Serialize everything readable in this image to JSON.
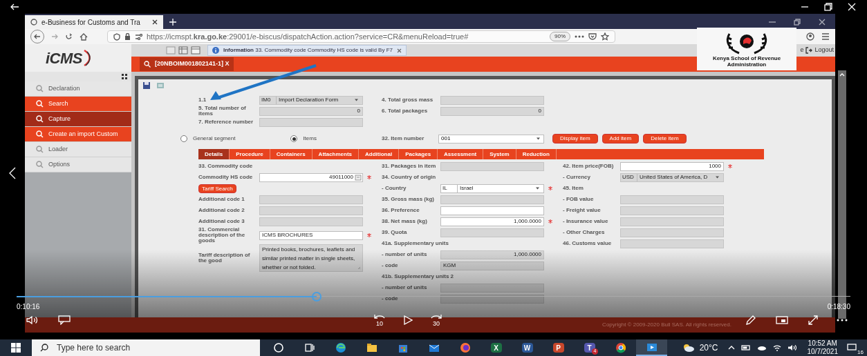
{
  "browser": {
    "tab_title": "e-Business for Customs and Tra",
    "url": "https://icmspt.**kra.go.ke**:29001/e-biscus/dispatchAction.action?service=CR&menuReload=true#",
    "zoom": "90%"
  },
  "app": {
    "logo": "iCMS",
    "info_tab": "**Information** 33. Commodity code Commodity HS code is valid By F7",
    "document_tab": "[20NBOIM001802141-1] X",
    "header_links": [
      "e",
      "Logout"
    ],
    "copyright": "Copyright © 2009-2020 Bull SAS. All rights reserved."
  },
  "overlay_logo": {
    "text": "Kenya School of Revenue Administration"
  },
  "sidebar": [
    {
      "label": "Declaration",
      "kind": "module",
      "selected": false
    },
    {
      "label": "Search",
      "kind": "action",
      "selected": false
    },
    {
      "label": "Capture",
      "kind": "action",
      "selected": true
    },
    {
      "label": "Create an import Custom",
      "kind": "action",
      "selected": false
    },
    {
      "label": "Loader",
      "kind": "module",
      "selected": false
    },
    {
      "label": "Options",
      "kind": "module",
      "selected": false
    }
  ],
  "form": {
    "header_columns": [
      {
        "rows": [
          {
            "kind": "select",
            "label": "1.1",
            "code": "IM0",
            "value": "Import Declaration Form",
            "editable": false,
            "required": false
          },
          {
            "kind": "number",
            "label": "5. Total number of items",
            "value": "0",
            "editable": false,
            "required": false
          },
          {
            "kind": "text",
            "label": "7. Reference number",
            "editable": false,
            "required": false
          }
        ]
      },
      {
        "rows": [
          {
            "kind": "text",
            "label": "4. Total gross mass",
            "editable": false,
            "required": false
          },
          {
            "kind": "number",
            "label": "6. Total packages",
            "value": "0",
            "editable": false,
            "required": false
          }
        ]
      }
    ],
    "segments": [
      {
        "label": "General segment",
        "selected": false
      },
      {
        "label": "Items",
        "selected": true
      }
    ],
    "item_number": {
      "label": "32. Item number",
      "value": "001"
    },
    "item_buttons": [
      "Display item",
      "Add item",
      "Delete item"
    ],
    "tabs": [
      {
        "label": "Details",
        "selected": true
      },
      {
        "label": "Procedure",
        "selected": false
      },
      {
        "label": "Containers",
        "selected": false
      },
      {
        "label": "Attachments",
        "selected": false
      },
      {
        "label": "Additional",
        "selected": false
      },
      {
        "label": "Packages",
        "selected": false
      },
      {
        "label": "Assessment",
        "selected": false
      },
      {
        "label": "System",
        "selected": false
      },
      {
        "label": "Reduction",
        "selected": false
      }
    ],
    "detail_columns": [
      {
        "rows": [
          {
            "kind": "heading",
            "label": "33. Commodity code"
          },
          {
            "kind": "lookup",
            "label": "Commodity HS code",
            "value": "49011000",
            "editable": true,
            "required": true
          },
          {
            "kind": "button",
            "label": "Tariff Search"
          },
          {
            "kind": "text",
            "label": "Additional code 1",
            "editable": false,
            "required": false
          },
          {
            "kind": "text",
            "label": "Additional code 2",
            "editable": false,
            "required": false
          },
          {
            "kind": "text",
            "label": "Additional code 3",
            "editable": false,
            "required": false
          },
          {
            "kind": "text",
            "label": "31. Commercial description of the goods",
            "value": "ICMS BROCHURES",
            "editable": true,
            "required": true
          },
          {
            "kind": "textarea",
            "label": "Tariff description of the good",
            "value": "Printed books, brochures, leaflets and similar printed matter in single sheets, whether or not folded.",
            "editable": false,
            "required": false
          }
        ]
      },
      {
        "rows": [
          {
            "kind": "text",
            "label": "31. Packages in item",
            "editable": false,
            "required": false
          },
          {
            "kind": "heading",
            "label": "34. Country of origin"
          },
          {
            "kind": "select",
            "label": "- Country",
            "code": "IL",
            "value": "Israel",
            "editable": true,
            "required": true
          },
          {
            "kind": "text",
            "label": "35. Gross mass (kg)",
            "editable": false,
            "required": false
          },
          {
            "kind": "text",
            "label": "36. Preference",
            "editable": true,
            "required": false
          },
          {
            "kind": "number",
            "label": "38. Net mass (kg)",
            "value": "1,000.0000",
            "editable": true,
            "required": true
          },
          {
            "kind": "text",
            "label": "39. Quota",
            "editable": false,
            "required": false
          },
          {
            "kind": "heading",
            "label": "41a. Supplementary units"
          },
          {
            "kind": "number",
            "label": "- number of units",
            "value": "1,000.0000",
            "editable": false,
            "required": false
          },
          {
            "kind": "text",
            "label": "- code",
            "value": "KGM",
            "editable": false,
            "required": false
          },
          {
            "kind": "heading",
            "label": "41b. Supplementary units 2"
          },
          {
            "kind": "text",
            "label": "- number of units",
            "editable": false,
            "required": false
          },
          {
            "kind": "text",
            "label": "- code",
            "editable": false,
            "required": false
          }
        ]
      },
      {
        "rows": [
          {
            "kind": "number",
            "label": "42. Item price(FOB)",
            "value": "1000",
            "editable": true,
            "required": true
          },
          {
            "kind": "select",
            "label": "- Currency",
            "code": "USD",
            "value": "United States of America, D",
            "editable": false,
            "required": false
          },
          {
            "kind": "heading",
            "label": "45. Item"
          },
          {
            "kind": "text",
            "label": "- FOB value",
            "editable": false,
            "required": false
          },
          {
            "kind": "text",
            "label": "- Freight value",
            "editable": false,
            "required": false
          },
          {
            "kind": "text",
            "label": "- Insurance value",
            "editable": false,
            "required": false
          },
          {
            "kind": "text",
            "label": "- Other Charges",
            "editable": false,
            "required": false
          },
          {
            "kind": "text",
            "label": "46. Customs value",
            "editable": false,
            "required": false
          }
        ]
      }
    ]
  },
  "video_player": {
    "current_time": "0:10:16",
    "total_time": "0:18:30",
    "progress": {
      "level": 0.36
    },
    "replay_seconds": "10",
    "forward_seconds": "30"
  },
  "taskbar": {
    "search_placeholder": "Type here to search",
    "apps": [
      {
        "kind": "cortana",
        "active": false
      },
      {
        "kind": "taskview",
        "active": false
      },
      {
        "kind": "edge",
        "active": false
      },
      {
        "kind": "explorer",
        "active": false
      },
      {
        "kind": "store",
        "active": false
      },
      {
        "kind": "mail",
        "active": false
      },
      {
        "kind": "firefox",
        "active": false
      },
      {
        "kind": "excel",
        "glyph": "X",
        "active": false
      },
      {
        "kind": "word",
        "glyph": "W",
        "active": false
      },
      {
        "kind": "powerpoint",
        "glyph": "P",
        "active": false
      },
      {
        "kind": "teams",
        "glyph": "T",
        "badge": "4",
        "active": false
      },
      {
        "kind": "chrome",
        "active": false
      },
      {
        "kind": "video",
        "active": true
      }
    ],
    "temperature": "20°C",
    "time": "10:52 AM",
    "date": "10/7/2021",
    "notifications": "16"
  }
}
